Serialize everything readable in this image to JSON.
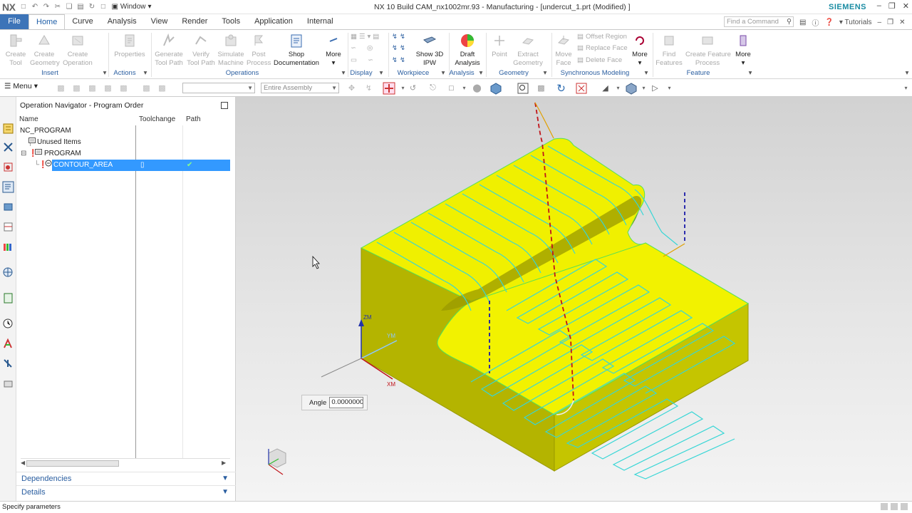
{
  "titlebar": {
    "logo": "NX",
    "window_menu": "Window",
    "app_title": "NX 10  Build CAM_nx1002mr.93 - Manufacturing - [undercut_1.prt (Modified) ]",
    "brand": "SIEMENS"
  },
  "tabs": [
    "File",
    "Home",
    "Curve",
    "Analysis",
    "View",
    "Render",
    "Tools",
    "Application",
    "Internal"
  ],
  "find_command_placeholder": "Find a Command",
  "tutorials_label": "Tutorials",
  "ribbon": {
    "insert": {
      "create_tool": "Create\nTool",
      "create_geometry": "Create\nGeometry",
      "create_operation": "Create\nOperation",
      "group": "Insert"
    },
    "actions": {
      "properties": "Properties",
      "group": "Actions"
    },
    "operations": {
      "generate_tool_path": "Generate\nTool Path",
      "verify_tool_path": "Verify\nTool Path",
      "simulate_machine": "Simulate\nMachine",
      "post_process": "Post\nProcess",
      "shop_documentation": "Shop\nDocumentation",
      "more": "More",
      "group": "Operations"
    },
    "display": {
      "group": "Display"
    },
    "workpiece": {
      "show_3d_ipw": "Show 3D\nIPW",
      "group": "Workpiece"
    },
    "analysis": {
      "draft_analysis": "Draft\nAnalysis",
      "group": "Analysis"
    },
    "geometry": {
      "point": "Point",
      "extract_geometry": "Extract\nGeometry",
      "group": "Geometry"
    },
    "synchronous": {
      "move_face": "Move\nFace",
      "offset_region": "Offset Region",
      "replace_face": "Replace Face",
      "delete_face": "Delete Face",
      "more": "More",
      "group": "Synchronous Modeling"
    },
    "feature": {
      "find_features": "Find\nFeatures",
      "create_feature_process": "Create Feature\nProcess",
      "more": "More",
      "group": "Feature"
    }
  },
  "toolbar": {
    "menu_label": "Menu",
    "filter_value": "",
    "assembly_scope": "Entire Assembly"
  },
  "navigator": {
    "title": "Operation Navigator - Program Order",
    "columns": [
      "Name",
      "Toolchange",
      "Path"
    ],
    "rows": [
      {
        "name": "NC_PROGRAM",
        "indent": 0
      },
      {
        "name": "Unused Items",
        "indent": 1
      },
      {
        "name": "PROGRAM",
        "indent": 1
      },
      {
        "name": "CONTOUR_AREA",
        "indent": 2,
        "selected": true
      }
    ],
    "panels": [
      "Dependencies",
      "Details"
    ]
  },
  "viewport": {
    "angle_label": "Angle",
    "angle_value": "0.0000000",
    "axis_zm": "ZM",
    "axis_ym": "YM",
    "axis_xm": "XM"
  },
  "status": "Specify parameters",
  "colors": {
    "accent": "#3d74b8",
    "selection": "#3399ff",
    "part_yellow": "#f0f000",
    "toolpath_cyan": "#38d6d6",
    "engage_red": "#c0141a",
    "retract_blue": "#1a1aa8"
  }
}
